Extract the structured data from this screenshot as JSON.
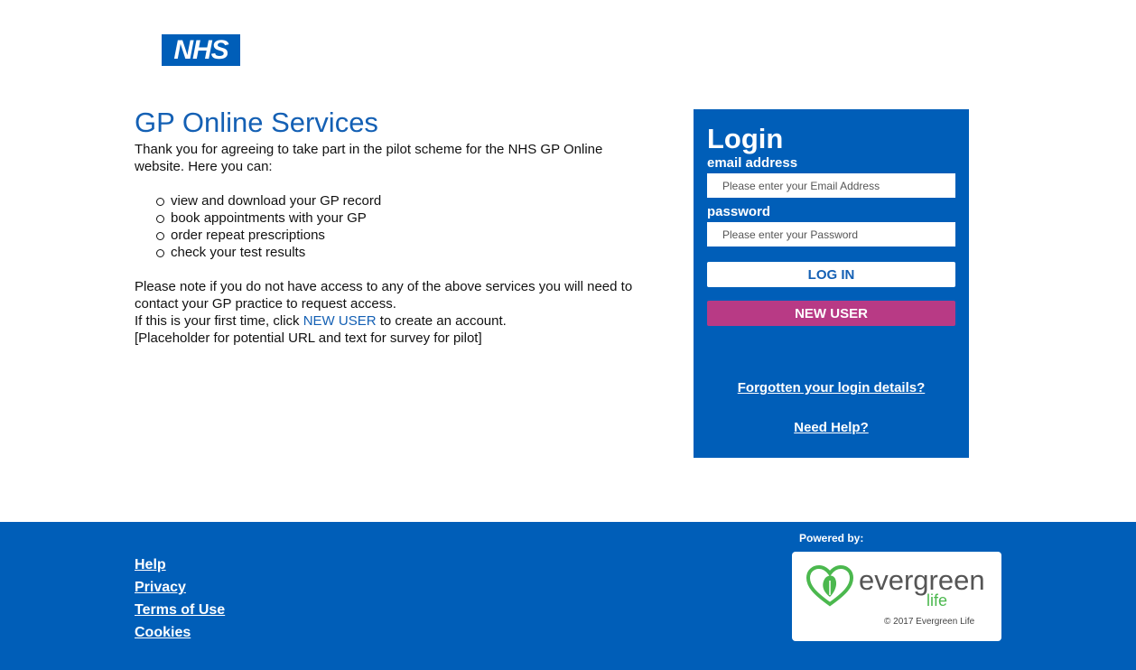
{
  "header": {
    "logo_text": "NHS"
  },
  "intro": {
    "title": "GP Online Services",
    "paragraph1": "Thank you for agreeing to take part in the pilot scheme for the NHS GP Online website. Here you can:",
    "bullets": [
      "view and download your GP record",
      "book appointments with your GP",
      "order repeat prescriptions",
      "check your test results"
    ],
    "note": "Please note if you do not have access to any of the above services you will need to contact your GP practice to request access.",
    "first_time_prefix": "If this is your first time, click ",
    "first_time_link": "NEW USER",
    "first_time_suffix": " to create an account.",
    "placeholder_text": "[Placeholder for potential URL and text for survey for pilot]"
  },
  "login": {
    "title": "Login",
    "email_label": "email address",
    "email_placeholder": "Please enter your Email Address",
    "email_value": "",
    "password_label": "password",
    "password_placeholder": "Please enter your Password",
    "password_value": "",
    "login_button": "LOG IN",
    "new_user_button": "NEW USER",
    "forgot_link": "Forgotten your login details?",
    "help_link": "Need Help?"
  },
  "footer": {
    "links": [
      "Help",
      "Privacy",
      "Terms of Use",
      "Cookies"
    ],
    "powered_by": "Powered by:",
    "brand_word": "evergreen",
    "brand_life": "life",
    "copyright": "© 2017 Evergreen Life"
  },
  "colors": {
    "nhs_blue": "#005eb8",
    "link_blue": "#1460b4",
    "new_user_pink": "#b83a85",
    "evergreen_green": "#4bb84e"
  }
}
